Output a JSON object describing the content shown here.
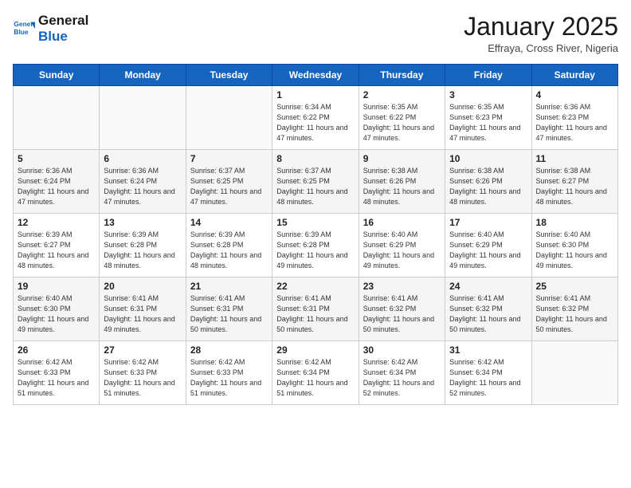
{
  "header": {
    "logo_line1": "General",
    "logo_line2": "Blue",
    "month": "January 2025",
    "location": "Effraya, Cross River, Nigeria"
  },
  "days_of_week": [
    "Sunday",
    "Monday",
    "Tuesday",
    "Wednesday",
    "Thursday",
    "Friday",
    "Saturday"
  ],
  "weeks": [
    [
      {
        "day": "",
        "info": ""
      },
      {
        "day": "",
        "info": ""
      },
      {
        "day": "",
        "info": ""
      },
      {
        "day": "1",
        "info": "Sunrise: 6:34 AM\nSunset: 6:22 PM\nDaylight: 11 hours and 47 minutes."
      },
      {
        "day": "2",
        "info": "Sunrise: 6:35 AM\nSunset: 6:22 PM\nDaylight: 11 hours and 47 minutes."
      },
      {
        "day": "3",
        "info": "Sunrise: 6:35 AM\nSunset: 6:23 PM\nDaylight: 11 hours and 47 minutes."
      },
      {
        "day": "4",
        "info": "Sunrise: 6:36 AM\nSunset: 6:23 PM\nDaylight: 11 hours and 47 minutes."
      }
    ],
    [
      {
        "day": "5",
        "info": "Sunrise: 6:36 AM\nSunset: 6:24 PM\nDaylight: 11 hours and 47 minutes."
      },
      {
        "day": "6",
        "info": "Sunrise: 6:36 AM\nSunset: 6:24 PM\nDaylight: 11 hours and 47 minutes."
      },
      {
        "day": "7",
        "info": "Sunrise: 6:37 AM\nSunset: 6:25 PM\nDaylight: 11 hours and 47 minutes."
      },
      {
        "day": "8",
        "info": "Sunrise: 6:37 AM\nSunset: 6:25 PM\nDaylight: 11 hours and 48 minutes."
      },
      {
        "day": "9",
        "info": "Sunrise: 6:38 AM\nSunset: 6:26 PM\nDaylight: 11 hours and 48 minutes."
      },
      {
        "day": "10",
        "info": "Sunrise: 6:38 AM\nSunset: 6:26 PM\nDaylight: 11 hours and 48 minutes."
      },
      {
        "day": "11",
        "info": "Sunrise: 6:38 AM\nSunset: 6:27 PM\nDaylight: 11 hours and 48 minutes."
      }
    ],
    [
      {
        "day": "12",
        "info": "Sunrise: 6:39 AM\nSunset: 6:27 PM\nDaylight: 11 hours and 48 minutes."
      },
      {
        "day": "13",
        "info": "Sunrise: 6:39 AM\nSunset: 6:28 PM\nDaylight: 11 hours and 48 minutes."
      },
      {
        "day": "14",
        "info": "Sunrise: 6:39 AM\nSunset: 6:28 PM\nDaylight: 11 hours and 48 minutes."
      },
      {
        "day": "15",
        "info": "Sunrise: 6:39 AM\nSunset: 6:28 PM\nDaylight: 11 hours and 49 minutes."
      },
      {
        "day": "16",
        "info": "Sunrise: 6:40 AM\nSunset: 6:29 PM\nDaylight: 11 hours and 49 minutes."
      },
      {
        "day": "17",
        "info": "Sunrise: 6:40 AM\nSunset: 6:29 PM\nDaylight: 11 hours and 49 minutes."
      },
      {
        "day": "18",
        "info": "Sunrise: 6:40 AM\nSunset: 6:30 PM\nDaylight: 11 hours and 49 minutes."
      }
    ],
    [
      {
        "day": "19",
        "info": "Sunrise: 6:40 AM\nSunset: 6:30 PM\nDaylight: 11 hours and 49 minutes."
      },
      {
        "day": "20",
        "info": "Sunrise: 6:41 AM\nSunset: 6:31 PM\nDaylight: 11 hours and 49 minutes."
      },
      {
        "day": "21",
        "info": "Sunrise: 6:41 AM\nSunset: 6:31 PM\nDaylight: 11 hours and 50 minutes."
      },
      {
        "day": "22",
        "info": "Sunrise: 6:41 AM\nSunset: 6:31 PM\nDaylight: 11 hours and 50 minutes."
      },
      {
        "day": "23",
        "info": "Sunrise: 6:41 AM\nSunset: 6:32 PM\nDaylight: 11 hours and 50 minutes."
      },
      {
        "day": "24",
        "info": "Sunrise: 6:41 AM\nSunset: 6:32 PM\nDaylight: 11 hours and 50 minutes."
      },
      {
        "day": "25",
        "info": "Sunrise: 6:41 AM\nSunset: 6:32 PM\nDaylight: 11 hours and 50 minutes."
      }
    ],
    [
      {
        "day": "26",
        "info": "Sunrise: 6:42 AM\nSunset: 6:33 PM\nDaylight: 11 hours and 51 minutes."
      },
      {
        "day": "27",
        "info": "Sunrise: 6:42 AM\nSunset: 6:33 PM\nDaylight: 11 hours and 51 minutes."
      },
      {
        "day": "28",
        "info": "Sunrise: 6:42 AM\nSunset: 6:33 PM\nDaylight: 11 hours and 51 minutes."
      },
      {
        "day": "29",
        "info": "Sunrise: 6:42 AM\nSunset: 6:34 PM\nDaylight: 11 hours and 51 minutes."
      },
      {
        "day": "30",
        "info": "Sunrise: 6:42 AM\nSunset: 6:34 PM\nDaylight: 11 hours and 52 minutes."
      },
      {
        "day": "31",
        "info": "Sunrise: 6:42 AM\nSunset: 6:34 PM\nDaylight: 11 hours and 52 minutes."
      },
      {
        "day": "",
        "info": ""
      }
    ]
  ]
}
